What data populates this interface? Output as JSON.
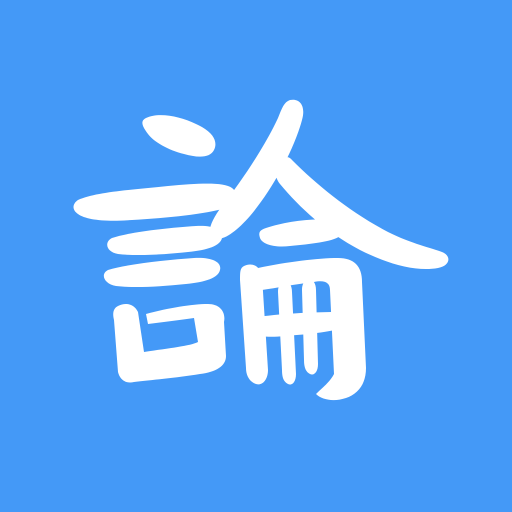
{
  "app_icon": {
    "character": "論",
    "colors": {
      "background": "#4499f7",
      "glyph": "#ffffff"
    },
    "icon": "calligraphy-character-icon"
  }
}
